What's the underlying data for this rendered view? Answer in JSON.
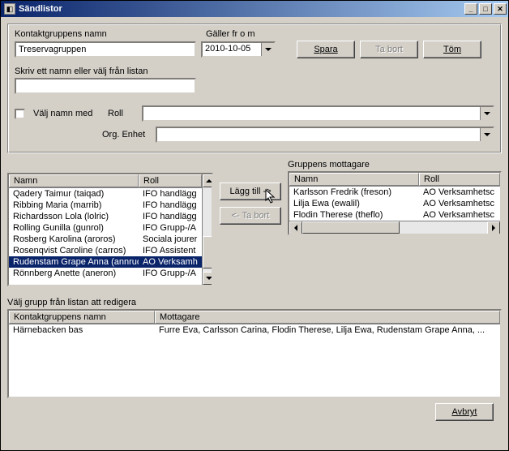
{
  "window": {
    "title": "Sändlistor"
  },
  "top": {
    "groupNameLabel": "Kontaktgruppens namn",
    "groupName": "Treservagruppen",
    "validFromLabel": "Gäller fr o m",
    "validFrom": "2010-10-05",
    "saveBtn": "Spara",
    "deleteBtn": "Ta bort",
    "clearBtn": "Töm",
    "typeNameLabel": "Skriv ett namn eller välj från listan",
    "typeNameValue": "",
    "selectNameWithLabel": "Välj namn med",
    "roleLabel": "Roll",
    "roleValue": "",
    "orgUnitLabel": "Org. Enhet",
    "orgUnitValue": ""
  },
  "leftList": {
    "col1": "Namn",
    "col2": "Roll",
    "rows": [
      {
        "name": "Qadery Taimur (taiqad)",
        "role": "IFO handlägg",
        "selected": false
      },
      {
        "name": "Ribbing Maria (marrib)",
        "role": "IFO handlägg",
        "selected": false
      },
      {
        "name": "Richardsson Lola (lolric)",
        "role": "IFO handlägg",
        "selected": false
      },
      {
        "name": "Rolling Gunilla (gunrol)",
        "role": "IFO Grupp-/A",
        "selected": false
      },
      {
        "name": "Rosberg Karolina (aroros)",
        "role": "Sociala jourer",
        "selected": false
      },
      {
        "name": "Rosenqvist Caroline (carros)",
        "role": "IFO Assistent",
        "selected": false
      },
      {
        "name": "Rudenstam Grape Anna (annrud)",
        "role": "AO Verksamh",
        "selected": true
      },
      {
        "name": "Rönnberg Anette (aneron)",
        "role": "IFO Grupp-/A",
        "selected": false
      }
    ]
  },
  "moveBtns": {
    "add": "Lägg till ->",
    "remove": "<- Ta bort"
  },
  "rightList": {
    "title": "Gruppens mottagare",
    "col1": "Namn",
    "col2": "Roll",
    "rows": [
      {
        "name": "Karlsson Fredrik (freson)",
        "role": "AO Verksamhetsc"
      },
      {
        "name": "Lilja Ewa (ewalil)",
        "role": "AO Verksamhetsc"
      },
      {
        "name": "Flodin Therese (theflo)",
        "role": "AO Verksamhetsc"
      }
    ]
  },
  "bottom": {
    "label": "Välj grupp från listan att redigera",
    "col1": "Kontaktgruppens namn",
    "col2": "Mottagare",
    "rows": [
      {
        "name": "Härnebacken bas",
        "recip": "Furre Eva, Carlsson Carina, Flodin Therese, Lilja Ewa, Rudenstam Grape Anna, ..."
      }
    ],
    "cancelBtn": "Avbryt"
  }
}
